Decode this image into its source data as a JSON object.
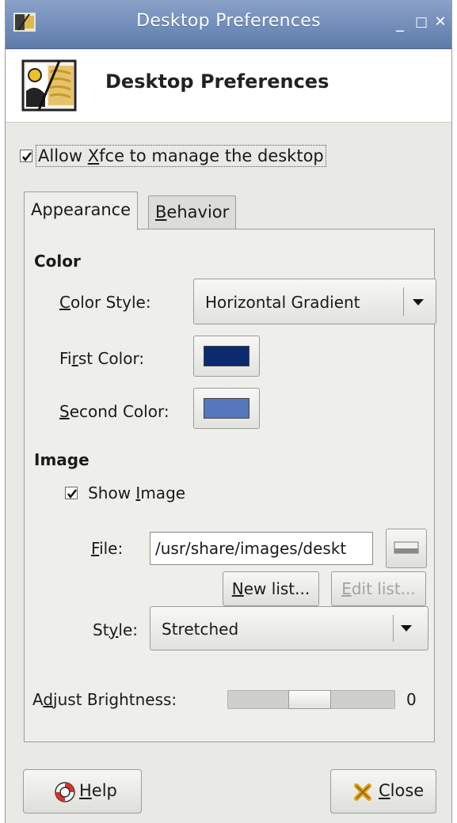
{
  "window": {
    "title": "Desktop Preferences",
    "controls": {
      "minimize": "_",
      "maximize": "□",
      "close": "✕"
    }
  },
  "header": {
    "title": "Desktop Preferences"
  },
  "manage": {
    "label_pre": "Allow ",
    "label_mn": "X",
    "label_post": "fce to manage the desktop",
    "checked": true
  },
  "tabs": [
    {
      "label": "Appearance",
      "active": true
    },
    {
      "label_mn": "B",
      "label_post": "ehavior",
      "active": false
    }
  ],
  "color": {
    "section_title": "Color",
    "style_label_mn": "C",
    "style_label_post": "olor Style:",
    "style_value": "Horizontal Gradient",
    "first_label_pre": "Fi",
    "first_label_mn": "r",
    "first_label_post": "st Color:",
    "first_color": "#0c2a6e",
    "second_label_mn": "S",
    "second_label_post": "econd Color:",
    "second_color": "#5577bb"
  },
  "image": {
    "section_title": "Image",
    "show_label_pre": "Show ",
    "show_label_mn": "I",
    "show_label_post": "mage",
    "show_checked": true,
    "file_label_mn": "F",
    "file_label_post": "ile:",
    "file_value": "/usr/share/images/deskt",
    "new_list_mn": "N",
    "new_list_post": "ew list...",
    "edit_list_mn": "E",
    "edit_list_post": "dit list...",
    "style_label_pre": "St",
    "style_label_mn": "y",
    "style_label_post": "le:",
    "style_value": "Stretched"
  },
  "brightness": {
    "label_pre": "A",
    "label_mn": "d",
    "label_post": "just Brightness:",
    "value": "0"
  },
  "footer": {
    "help_mn": "H",
    "help_post": "elp",
    "close_mn": "C",
    "close_post": "lose"
  },
  "colors": {
    "titlebar": "#6f8bb8",
    "panel": "#eeeeeb"
  }
}
